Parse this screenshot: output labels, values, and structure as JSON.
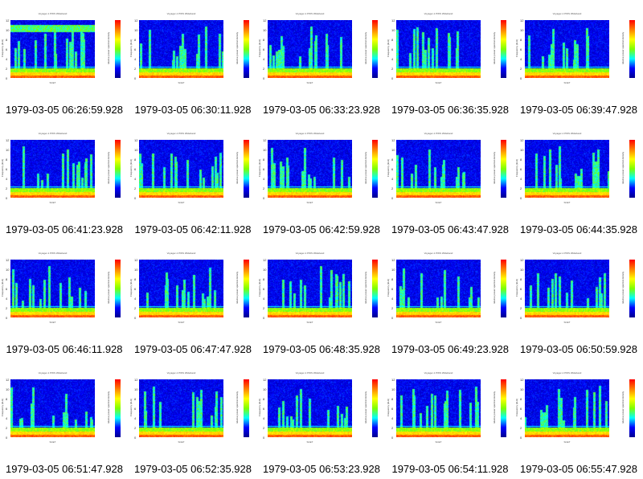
{
  "plot": {
    "title": "Voyager-1 PWS Wideband",
    "ylabel": "Frequency (kHz)",
    "colorbar_label": "relative power spectral density",
    "xunit": "SCET",
    "yticks": [
      "12",
      "10",
      "8",
      "6",
      "4",
      "2",
      "0"
    ]
  },
  "captions": [
    "1979-03-05 06:26:59.928",
    "1979-03-05 06:30:11.928",
    "1979-03-05 06:33:23.928",
    "1979-03-05 06:36:35.928",
    "1979-03-05 06:39:47.928",
    "1979-03-05 06:41:23.928",
    "1979-03-05 06:42:11.928",
    "1979-03-05 06:42:59.928",
    "1979-03-05 06:43:47.928",
    "1979-03-05 06:44:35.928",
    "1979-03-05 06:46:11.928",
    "1979-03-05 06:47:47.928",
    "1979-03-05 06:48:35.928",
    "1979-03-05 06:49:23.928",
    "1979-03-05 06:50:59.928",
    "1979-03-05 06:51:47.928",
    "1979-03-05 06:52:35.928",
    "1979-03-05 06:53:23.928",
    "1979-03-05 06:54:11.928",
    "1979-03-05 06:55:47.928"
  ]
}
